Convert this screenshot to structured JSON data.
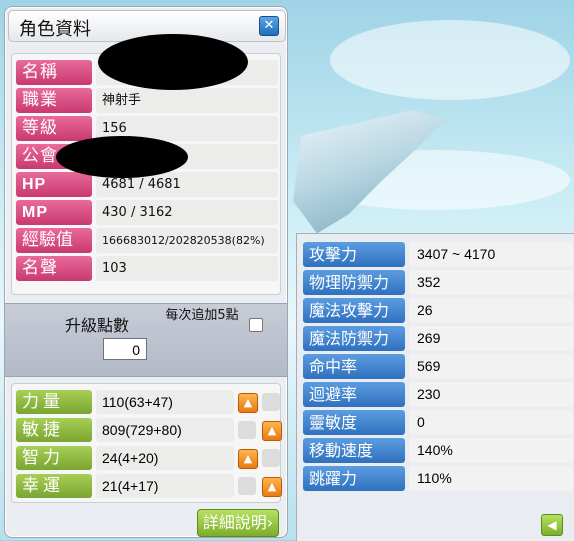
{
  "window": {
    "title": "角色資料",
    "close_icon": "close-icon"
  },
  "info": [
    {
      "key": "name",
      "label": "名稱",
      "value": ""
    },
    {
      "key": "job",
      "label": "職業",
      "value": "神射手"
    },
    {
      "key": "level",
      "label": "等級",
      "value": "156"
    },
    {
      "key": "guild",
      "label": "公會",
      "value": ""
    },
    {
      "key": "hp",
      "label": "HP",
      "value": "4681 / 4681"
    },
    {
      "key": "mp",
      "label": "MP",
      "value": "430 / 3162"
    },
    {
      "key": "exp",
      "label": "經驗值",
      "value": "166683012/202820538(82%)"
    },
    {
      "key": "fame",
      "label": "名聲",
      "value": "103"
    }
  ],
  "ability_points": {
    "label": "升級點數",
    "value": "0",
    "auto_label": "每次追加5點",
    "auto_checked": false
  },
  "stats": [
    {
      "key": "str",
      "label": "力量",
      "value": "110(63+47)"
    },
    {
      "key": "dex",
      "label": "敏捷",
      "value": "809(729+80)"
    },
    {
      "key": "int",
      "label": "智力",
      "value": "24(4+20)"
    },
    {
      "key": "luk",
      "label": "幸運",
      "value": "21(4+17)"
    }
  ],
  "detail_button": {
    "label": "詳細說明",
    "icon": "chevron-right-icon"
  },
  "detail_stats": [
    {
      "label": "攻擊力",
      "value": "3407 ~ 4170"
    },
    {
      "label": "物理防禦力",
      "value": "352"
    },
    {
      "label": "魔法攻擊力",
      "value": "26"
    },
    {
      "label": "魔法防禦力",
      "value": "269"
    },
    {
      "label": "命中率",
      "value": "569"
    },
    {
      "label": "迴避率",
      "value": "230"
    },
    {
      "label": "靈敏度",
      "value": "0"
    },
    {
      "label": "移動速度",
      "value": "140%"
    },
    {
      "label": "跳躍力",
      "value": "110%"
    }
  ],
  "back_button": {
    "icon": "chevron-left-icon"
  },
  "colors": {
    "info_label": "#d24a7f",
    "stat_label": "#8bb83e",
    "detail_label": "#3f80cc",
    "arrow": "#f08a1c"
  }
}
